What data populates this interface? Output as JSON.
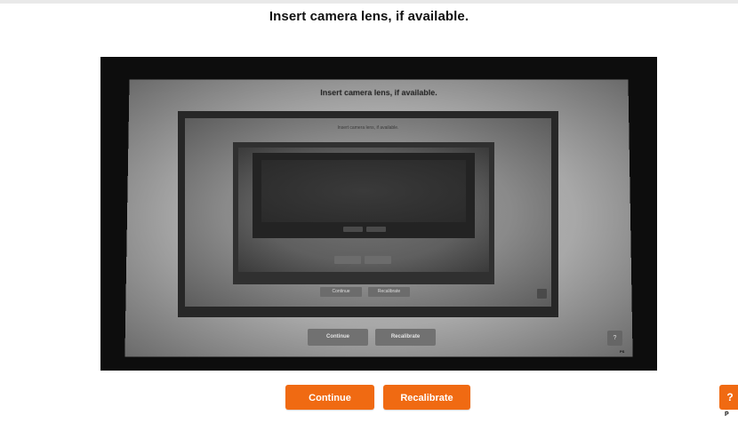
{
  "header": {
    "title": "Insert camera lens, if available."
  },
  "camera_view": {
    "title_1": "Insert camera lens, if available.",
    "title_2": "Insert camera lens, if available.",
    "continue_label": "Continue",
    "recalibrate_label": "Recalibrate",
    "mini_continue_label": "Continue",
    "mini_recalibrate_label": "Recalibrate",
    "help_label": "?",
    "help_sub": "PS"
  },
  "actions": {
    "continue_label": "Continue",
    "recalibrate_label": "Recalibrate"
  },
  "help": {
    "label": "?",
    "sub": "P"
  },
  "colors": {
    "accent": "#f06a12"
  }
}
